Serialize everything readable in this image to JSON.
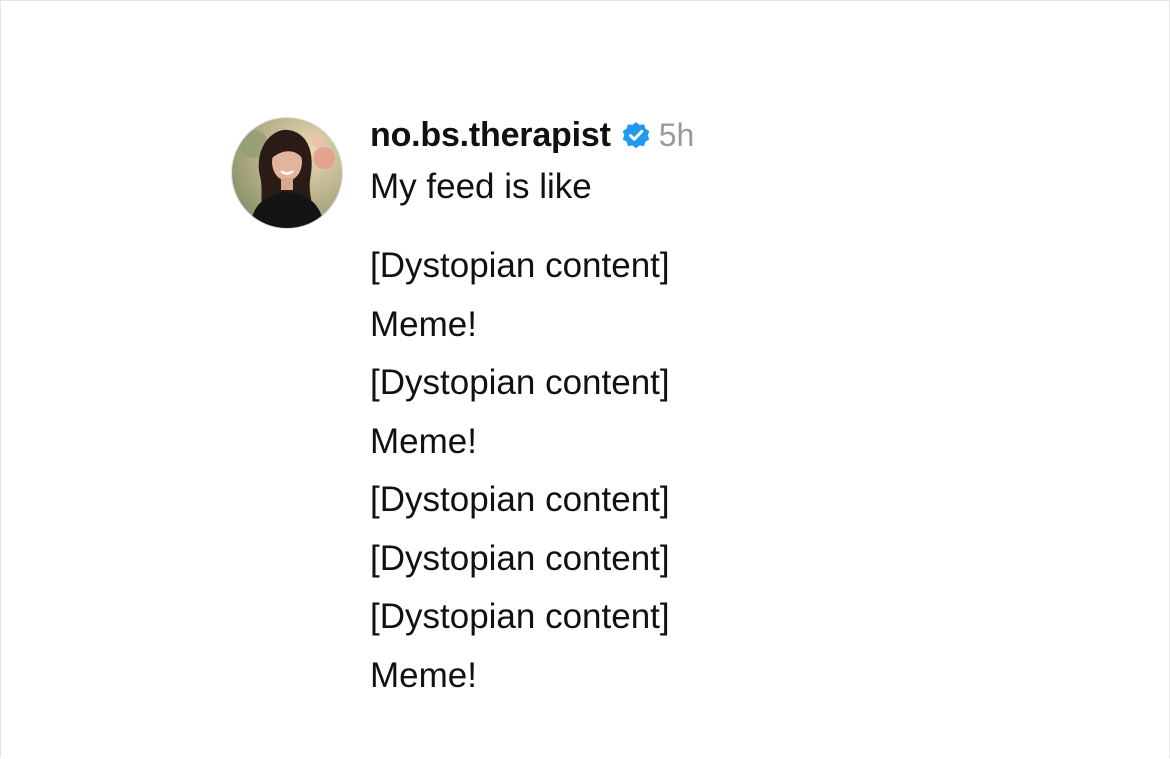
{
  "post": {
    "username": "no.bs.therapist",
    "timestamp": "5h",
    "verified": true,
    "verified_color": "#1e9bf0",
    "first_line": "My feed is like",
    "lines": [
      "[Dystopian content]",
      "Meme!",
      "[Dystopian content]",
      "Meme!",
      "[Dystopian content]",
      "[Dystopian content]",
      "[Dystopian content]",
      "Meme!"
    ]
  },
  "icons": {
    "avatar": "profile-photo",
    "badge": "verified-badge-icon"
  }
}
